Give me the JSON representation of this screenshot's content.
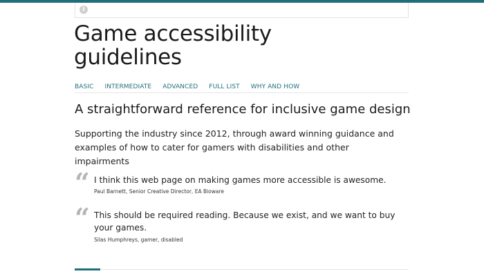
{
  "colors": {
    "accent": "#1f6f7a",
    "quote_mark": "#b5b5b5",
    "text": "#222222"
  },
  "header": {
    "info_icon": "info-icon",
    "info_glyph": "i"
  },
  "site": {
    "title": "Game accessibility guidelines"
  },
  "nav": {
    "items": [
      "BASIC",
      "INTERMEDIATE",
      "ADVANCED",
      "FULL LIST",
      "WHY AND HOW"
    ]
  },
  "main": {
    "subtitle": "A straightforward reference for inclusive game design",
    "intro": "Supporting the industry since 2012, through award winning guidance and examples of how to cater for gamers with disabilities and other impairments",
    "quotes": [
      {
        "mark": "“",
        "text": "I think this web page on making games more accessible is awesome.",
        "attribution": "Paul Barnett, Senior Creative Director, EA Bioware"
      },
      {
        "mark": "“",
        "text": "This should be required reading. Because we exist, and we want to buy your games.",
        "attribution": "Silas Humphreys, gamer, disabled"
      }
    ]
  }
}
